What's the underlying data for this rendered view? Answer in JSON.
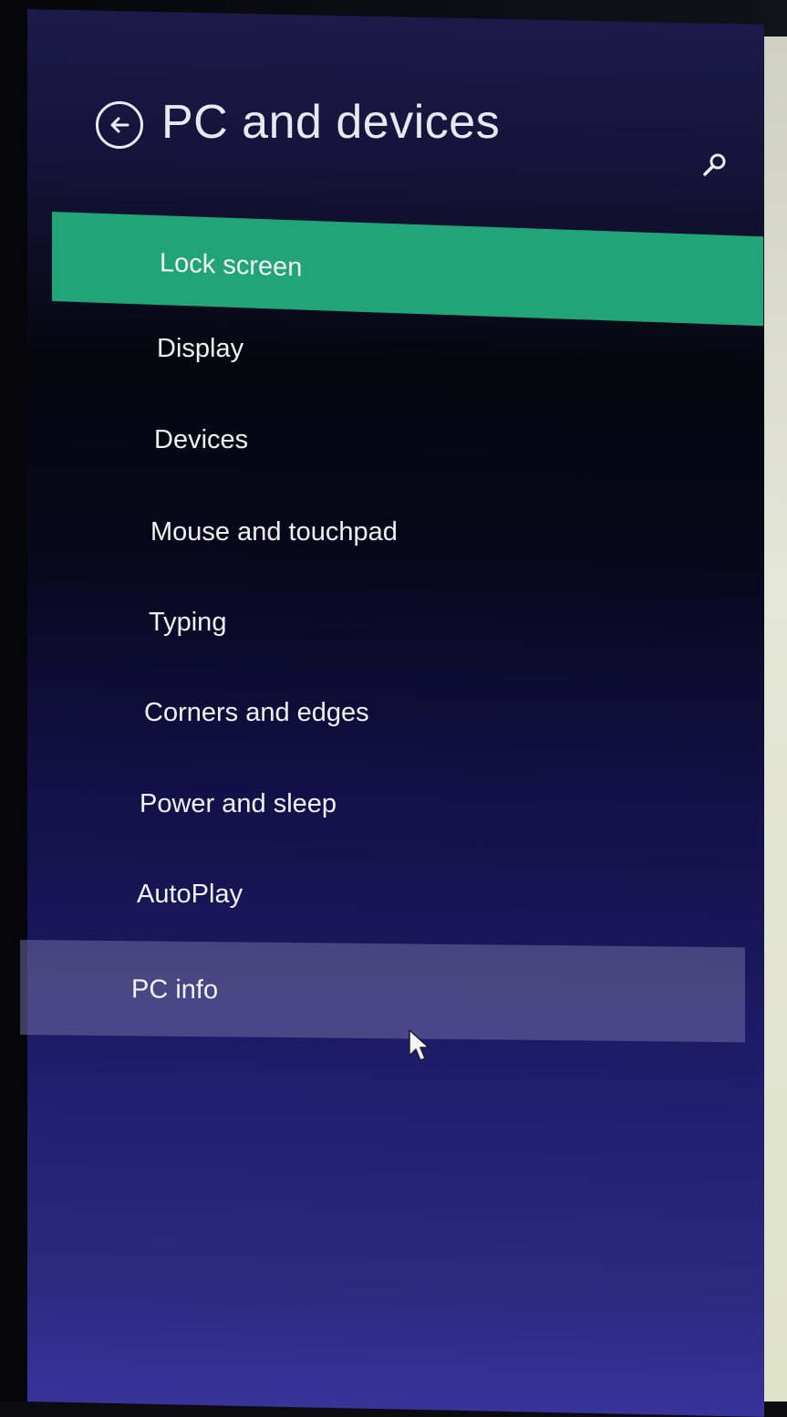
{
  "header": {
    "title": "PC and devices",
    "back_icon": "back-arrow-circle-icon",
    "search_icon": "search-icon"
  },
  "menu": {
    "items": [
      {
        "label": "Lock screen",
        "state": "selected"
      },
      {
        "label": "Display"
      },
      {
        "label": "Devices"
      },
      {
        "label": "Mouse and touchpad"
      },
      {
        "label": "Typing"
      },
      {
        "label": "Corners and edges"
      },
      {
        "label": "Power and sleep"
      },
      {
        "label": "AutoPlay"
      },
      {
        "label": "PC info",
        "state": "hovered"
      }
    ]
  },
  "colors": {
    "accent_selected": "#21a578",
    "hover_highlight": "#6e6ca0",
    "background_top": "#141236",
    "background_bottom": "#36339a",
    "text": "#f2f2f4"
  }
}
